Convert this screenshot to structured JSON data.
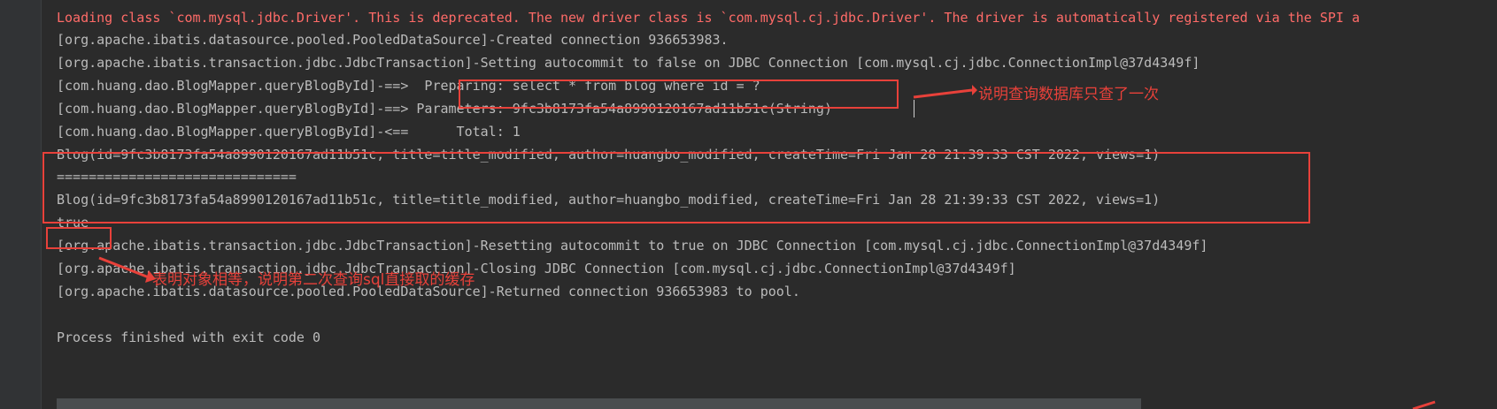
{
  "console": {
    "clipped_top": "....... ....... ........ . ..... ...... .. .. ........... . .....",
    "lines": [
      {
        "text": "Loading class `com.mysql.jdbc.Driver'. This is deprecated. The new driver class is `com.mysql.cj.jdbc.Driver'. The driver is automatically registered via the SPI a",
        "type": "error"
      },
      {
        "text": "[org.apache.ibatis.datasource.pooled.PooledDataSource]-Created connection 936653983.",
        "type": "normal"
      },
      {
        "text": "[org.apache.ibatis.transaction.jdbc.JdbcTransaction]-Setting autocommit to false on JDBC Connection [com.mysql.cj.jdbc.ConnectionImpl@37d4349f]",
        "type": "normal"
      },
      {
        "text": "[com.huang.dao.BlogMapper.queryBlogById]-==>  Preparing: select * from blog where id = ?",
        "type": "normal"
      },
      {
        "text": "[com.huang.dao.BlogMapper.queryBlogById]-==> Parameters: 9fc3b8173fa54a8990120167ad11b51c(String)",
        "type": "normal"
      },
      {
        "text": "[com.huang.dao.BlogMapper.queryBlogById]-<==      Total: 1",
        "type": "normal"
      },
      {
        "text": "Blog(id=9fc3b8173fa54a8990120167ad11b51c, title=title_modified, author=huangbo_modified, createTime=Fri Jan 28 21:39:33 CST 2022, views=1)",
        "type": "normal"
      },
      {
        "text": "==============================",
        "type": "normal"
      },
      {
        "text": "Blog(id=9fc3b8173fa54a8990120167ad11b51c, title=title_modified, author=huangbo_modified, createTime=Fri Jan 28 21:39:33 CST 2022, views=1)",
        "type": "normal"
      },
      {
        "text": "true",
        "type": "normal"
      },
      {
        "text": "[org.apache.ibatis.transaction.jdbc.JdbcTransaction]-Resetting autocommit to true on JDBC Connection [com.mysql.cj.jdbc.ConnectionImpl@37d4349f]",
        "type": "normal"
      },
      {
        "text": "[org.apache.ibatis.transaction.jdbc.JdbcTransaction]-Closing JDBC Connection [com.mysql.cj.jdbc.ConnectionImpl@37d4349f]",
        "type": "normal"
      },
      {
        "text": "[org.apache.ibatis.datasource.pooled.PooledDataSource]-Returned connection 936653983 to pool.",
        "type": "normal"
      },
      {
        "text": "",
        "type": "normal"
      },
      {
        "text": "Process finished with exit code 0",
        "type": "normal"
      }
    ]
  },
  "annotations": {
    "note_sql_once": "说明查询数据库只查了一次",
    "note_same_object": "表明对象相等，说明第二次查询sql直接取的缓存"
  },
  "colors": {
    "background": "#2b2b2b",
    "text": "#bbbbbb",
    "error_text": "#ff6b68",
    "annotation_red": "#e8413a"
  }
}
